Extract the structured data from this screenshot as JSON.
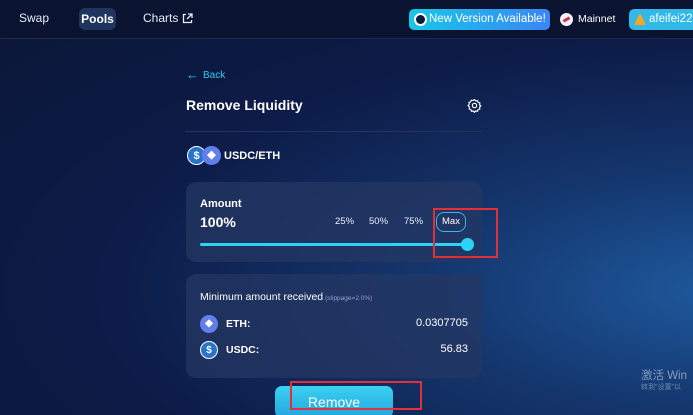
{
  "nav": {
    "swap": "Swap",
    "pools": "Pools",
    "charts": "Charts"
  },
  "header": {
    "version_badge": "New Version Available!",
    "network": "Mainnet",
    "account": "afeifei22"
  },
  "page": {
    "back": "Back",
    "title": "Remove Liquidity",
    "pair": "USDC/ETH"
  },
  "amount": {
    "label": "Amount",
    "value": "100%",
    "options": [
      "25%",
      "50%",
      "75%",
      "Max"
    ],
    "slider_fraction": 1.0
  },
  "receive": {
    "title": "Minimum amount received",
    "slippage": "(slippage=2.0%)",
    "tokens": [
      {
        "symbol": "ETH:",
        "amount": "0.0307705"
      },
      {
        "symbol": "USDC:",
        "amount": "56.83"
      }
    ]
  },
  "actions": {
    "remove": "Remove"
  },
  "watermark": {
    "line1": "激活 Win",
    "line2": "转到\"设置\"以"
  },
  "colors": {
    "accent": "#2ad4f2",
    "highlight": "#e2303b",
    "background": "#0d1c48"
  }
}
